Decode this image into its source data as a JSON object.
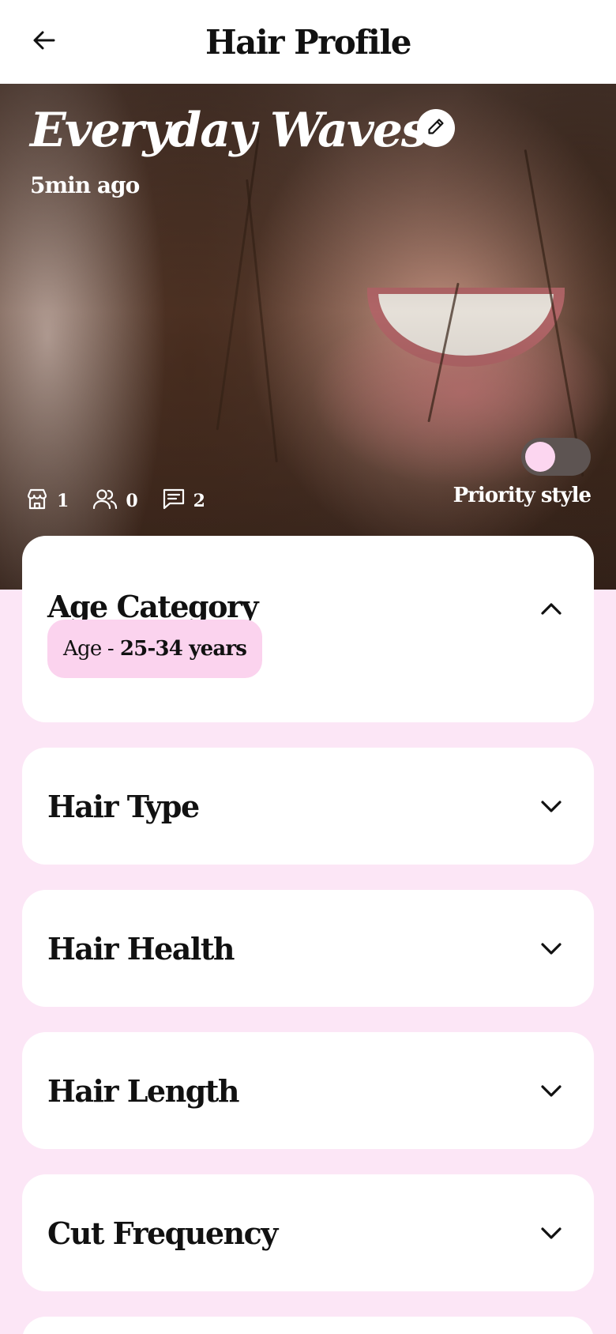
{
  "header": {
    "title": "Hair Profile",
    "back_icon": "arrow-left-icon"
  },
  "hero": {
    "title": "Everyday Waves",
    "updated": "5min ago",
    "edit_icon": "pencil-icon",
    "stats": [
      {
        "icon": "store-icon",
        "value": "1"
      },
      {
        "icon": "users-icon",
        "value": "0"
      },
      {
        "icon": "message-icon",
        "value": "2"
      }
    ],
    "toggle_label": "Priority style",
    "toggle_on": false
  },
  "sections": [
    {
      "title": "Age Category",
      "expanded": true,
      "chip_prefix": "Age -",
      "chip_value": "25-34 years"
    },
    {
      "title": "Hair Type",
      "expanded": false
    },
    {
      "title": "Hair Health",
      "expanded": false
    },
    {
      "title": "Hair Length",
      "expanded": false
    },
    {
      "title": "Cut Frequency",
      "expanded": false
    }
  ],
  "colors": {
    "page_bg": "#FCE6F6",
    "chip_bg": "#FBD3EE",
    "toggle_knob": "#FCD6F0",
    "card_bg": "#FFFFFF"
  }
}
